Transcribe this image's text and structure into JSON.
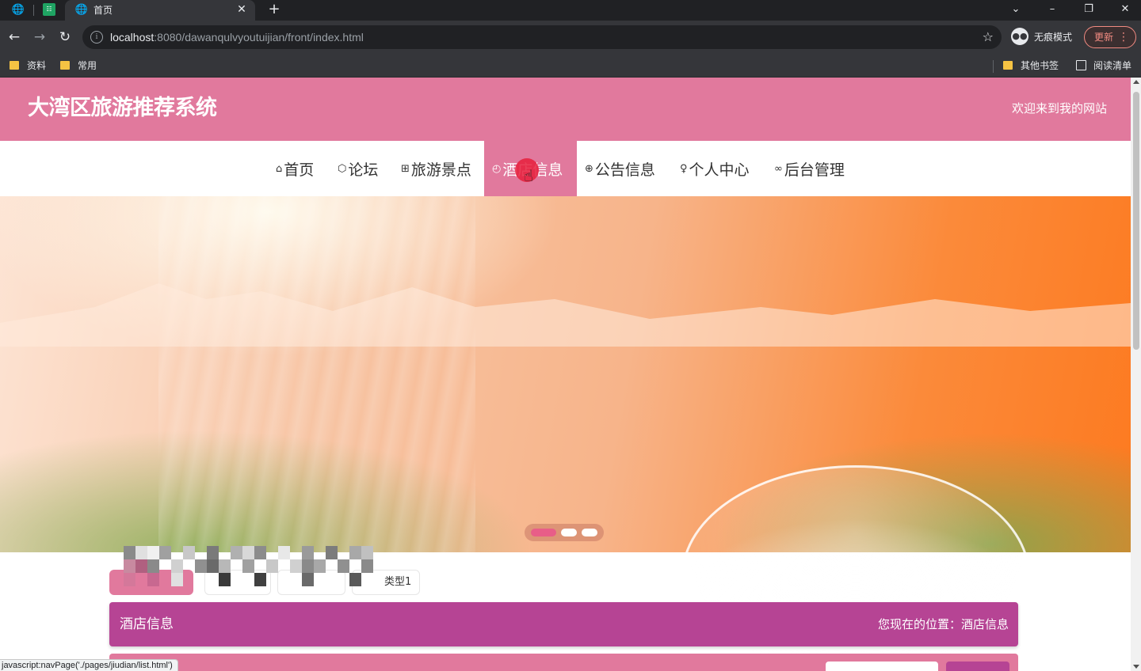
{
  "browser": {
    "tab_title": "首页",
    "url_host": "localhost",
    "url_rest": ":8080/dawanqulvyoutuijian/front/index.html",
    "incognito_label": "无痕模式",
    "update_label": "更新",
    "bookmarks": [
      "资料",
      "常用"
    ],
    "other_bookmarks": "其他书签",
    "reading_list": "阅读清单",
    "status_url": "javascript:navPage('./pages/jiudian/list.html')"
  },
  "site": {
    "title": "大湾区旅游推荐系统",
    "welcome": "欢迎来到我的网站"
  },
  "nav": {
    "items": [
      {
        "label": "首页",
        "icon": "home-icon"
      },
      {
        "label": "论坛",
        "icon": "cube-icon"
      },
      {
        "label": "旅游景点",
        "icon": "gift-icon"
      },
      {
        "label": "酒店信息",
        "icon": "clock-icon"
      },
      {
        "label": "公告信息",
        "icon": "globe-icon"
      },
      {
        "label": "个人中心",
        "icon": "user-icon"
      },
      {
        "label": "后台管理",
        "icon": "link-icon"
      }
    ],
    "active_index": 3
  },
  "type_tabs": {
    "visible_label": "类型1"
  },
  "section": {
    "title": "酒店信息",
    "location": "您现在的位置：酒店信息"
  },
  "colors": {
    "header": "#e1799d",
    "section_bar": "#b64494",
    "accent": "#e85e88"
  }
}
